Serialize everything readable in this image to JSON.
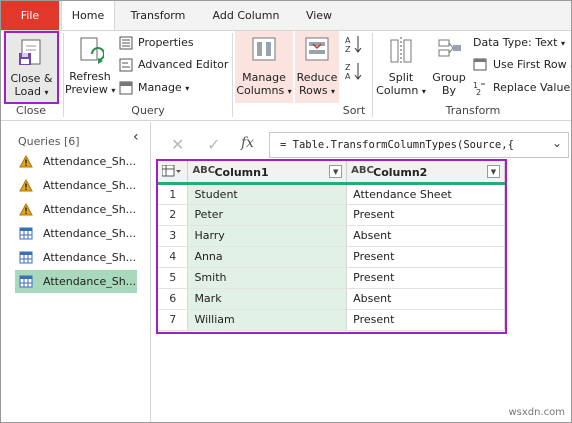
{
  "tabs": [
    "File",
    "Home",
    "Transform",
    "Add Column",
    "View"
  ],
  "ribbon": {
    "close_load": {
      "line1": "Close &",
      "line2": "Load"
    },
    "close_group": "Close",
    "refresh": {
      "line1": "Refresh",
      "line2": "Preview"
    },
    "properties": "Properties",
    "advanced_editor": "Advanced Editor",
    "manage": "Manage",
    "query_group": "Query",
    "manage_columns": {
      "line1": "Manage",
      "line2": "Columns"
    },
    "reduce_rows": {
      "line1": "Reduce",
      "line2": "Rows"
    },
    "sort_group": "Sort",
    "split_column": {
      "line1": "Split",
      "line2": "Column"
    },
    "group_by": {
      "line1": "Group",
      "line2": "By"
    },
    "data_type": "Data Type: Text",
    "use_first_row": "Use First Row a",
    "replace_values": "Replace Values",
    "transform_group": "Transform"
  },
  "queries": {
    "title": "Queries [6]",
    "items": [
      {
        "label": "Attendance_Sh...",
        "icon": "warning-icon",
        "selected": false
      },
      {
        "label": "Attendance_Sh...",
        "icon": "warning-icon",
        "selected": false
      },
      {
        "label": "Attendance_Sh...",
        "icon": "warning-icon",
        "selected": false
      },
      {
        "label": "Attendance_Sh...",
        "icon": "table-icon",
        "selected": false
      },
      {
        "label": "Attendance_Sh...",
        "icon": "table-icon",
        "selected": false
      },
      {
        "label": "Attendance_Sh...",
        "icon": "table-icon",
        "selected": true
      }
    ]
  },
  "formula": {
    "x_label": "✕",
    "check_label": "✓",
    "fx_label": "fx",
    "text": "= Table.TransformColumnTypes(Source,{"
  },
  "grid": {
    "columns": [
      {
        "name": "Column1",
        "type": "ABC"
      },
      {
        "name": "Column2",
        "type": "ABC"
      }
    ],
    "rows": [
      {
        "n": "1",
        "c1": "Student",
        "c2": "Attendance Sheet"
      },
      {
        "n": "2",
        "c1": "Peter",
        "c2": "Present"
      },
      {
        "n": "3",
        "c1": "Harry",
        "c2": "Absent"
      },
      {
        "n": "4",
        "c1": "Anna",
        "c2": "Present"
      },
      {
        "n": "5",
        "c1": "Smith",
        "c2": "Present"
      },
      {
        "n": "6",
        "c1": "Mark",
        "c2": "Absent"
      },
      {
        "n": "7",
        "c1": "William",
        "c2": "Present"
      }
    ]
  },
  "watermark": "wsxdn.com",
  "colors": {
    "file_tab": "#e0382b",
    "highlight_border": "#a020c8",
    "selected_query": "#a8d9bd",
    "column_accent": "#2aa87a"
  }
}
